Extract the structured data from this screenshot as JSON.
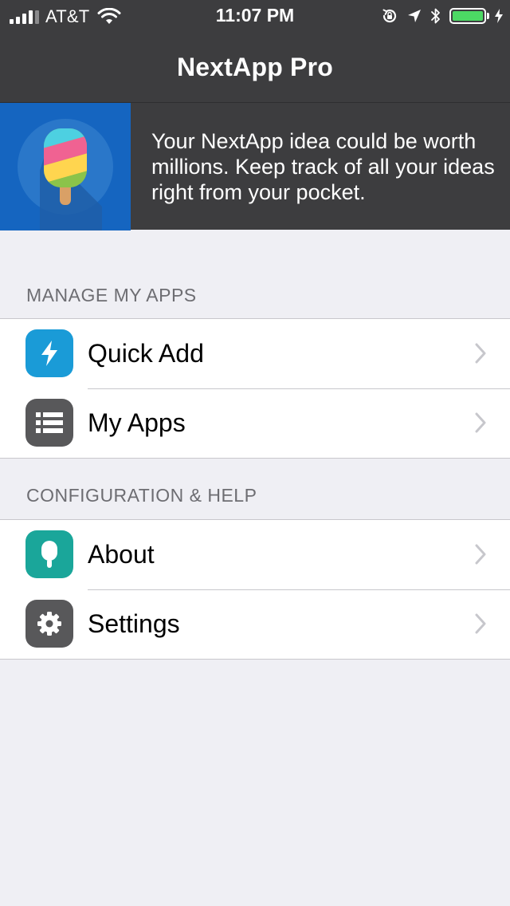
{
  "status_bar": {
    "carrier": "AT&T",
    "time": "11:07 PM",
    "signal_strength": 4,
    "battery_level": 1.0,
    "battery_color": "#4cd964"
  },
  "nav": {
    "title": "NextApp Pro"
  },
  "banner": {
    "text": "Your NextApp idea could be worth millions. Keep track of all your ideas right from your pocket.",
    "image_icon": "popsicle-logo-icon"
  },
  "sections": [
    {
      "header": "MANAGE MY APPS",
      "items": [
        {
          "label": "Quick Add",
          "icon": "lightning-icon",
          "icon_color": "#1a9bd7"
        },
        {
          "label": "My Apps",
          "icon": "list-icon",
          "icon_color": "#58585a"
        }
      ]
    },
    {
      "header": "CONFIGURATION & HELP",
      "items": [
        {
          "label": "About",
          "icon": "popsicle-icon",
          "icon_color": "#1aa69a"
        },
        {
          "label": "Settings",
          "icon": "gear-icon",
          "icon_color": "#58585a"
        }
      ]
    }
  ],
  "colors": {
    "nav_background": "#3d3d3f",
    "page_background": "#efeff4",
    "banner_image_background": "#1565c0"
  }
}
